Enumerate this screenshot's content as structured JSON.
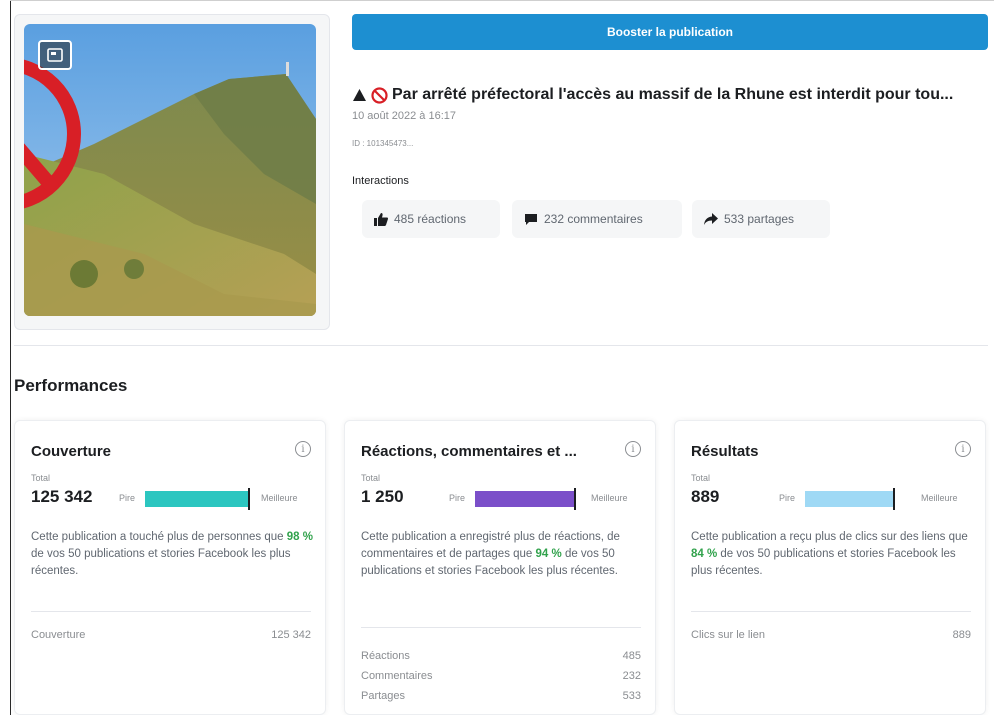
{
  "boost_button": {
    "label": "Booster la publication"
  },
  "post": {
    "title": "Par arrêté préfectoral l'accès au massif de la Rhune est interdit pour tou...",
    "date": "10 août 2022 à 16:17",
    "id": "ID : 101345473...",
    "interactions_label": "Interactions",
    "chips": [
      {
        "icon": "thumbs-up-icon",
        "label": "485 réactions"
      },
      {
        "icon": "comment-icon",
        "label": "232 commentaires"
      },
      {
        "icon": "share-icon",
        "label": "533 partages"
      }
    ]
  },
  "performances": {
    "title": "Performances",
    "cards": [
      {
        "title": "Couverture",
        "total_label": "Total",
        "total": "125 342",
        "low": "Pire",
        "high": "Meilleure",
        "bar_color": "#2cc6c0",
        "level": 0.98,
        "desc_before": "Cette publication a touché plus de personnes que ",
        "pct": "98 %",
        "desc_after": " de vos 50 publications et stories Facebook les plus récentes.",
        "metrics": [
          {
            "label": "Couverture",
            "value": "125 342"
          }
        ]
      },
      {
        "title": "Réactions, commentaires et ...",
        "total_label": "Total",
        "total": "1 250",
        "low": "Pire",
        "high": "Meilleure",
        "bar_color": "#7b4fc9",
        "level": 0.94,
        "desc_before": "Cette publication a enregistré plus de réactions, de commentaires et de partages que ",
        "pct": "94 %",
        "desc_after": " de vos 50 publications et stories Facebook les plus récentes.",
        "metrics": [
          {
            "label": "Réactions",
            "value": "485"
          },
          {
            "label": "Commentaires",
            "value": "232"
          },
          {
            "label": "Partages",
            "value": "533"
          }
        ]
      },
      {
        "title": "Résultats",
        "total_label": "Total",
        "total": "889",
        "low": "Pire",
        "high": "Meilleure",
        "bar_color": "#9fd9f5",
        "level": 0.84,
        "desc_before": "Cette publication a reçu plus de clics sur des liens que ",
        "pct": "84 %",
        "desc_after": " de vos 50 publications et stories Facebook les plus récentes.",
        "metrics": [
          {
            "label": "Clics sur le lien",
            "value": "889"
          }
        ]
      }
    ]
  },
  "colors": {
    "accent": "#1d8fd1",
    "positive": "#31a24c"
  }
}
